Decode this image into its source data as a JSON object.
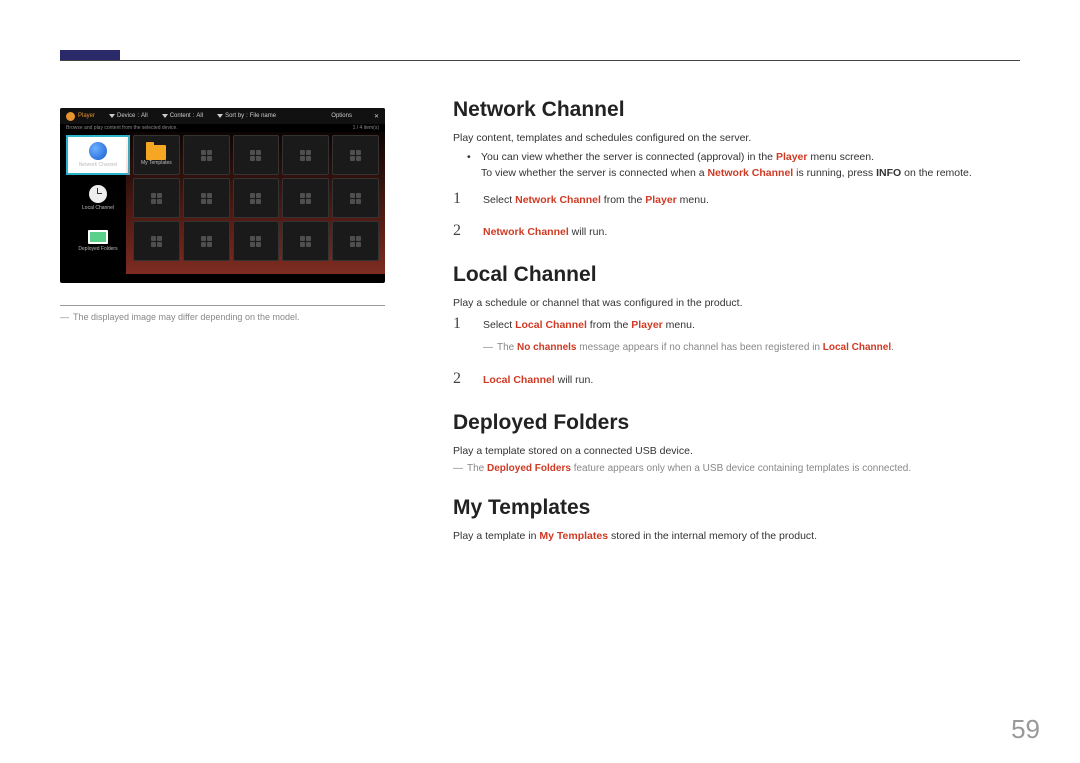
{
  "page_number": "59",
  "figure": {
    "header": {
      "player": "Player",
      "device": "Device",
      "device_val": "All",
      "content": "Content",
      "content_val": "All",
      "sortby": "Sort by",
      "sortby_val": "File name",
      "options": "Options",
      "close": "✕"
    },
    "subline_left": "Browse and play content from the selected device.",
    "subline_right": "1 / 4 item(s)",
    "side": {
      "network": "Network Channel",
      "templates": "My Templates",
      "local": "Local Channel",
      "deployed": "Deployed Folders"
    }
  },
  "figure_note": "The displayed image may differ depending on the model.",
  "sections": {
    "network": {
      "heading": "Network Channel",
      "desc": "Play content, templates and schedules configured on the server.",
      "bullet_pre": "You can view whether the server is connected (approval) in the ",
      "bullet_hl1": "Player",
      "bullet_post1": " menu screen.",
      "bullet_line2_pre": "To view whether the server is connected when a ",
      "bullet_line2_hl": "Network Channel",
      "bullet_line2_mid": " is running, press ",
      "bullet_line2_bold": "INFO",
      "bullet_line2_post": " on the remote.",
      "step1_pre": "Select ",
      "step1_hl1": "Network Channel",
      "step1_mid": " from the ",
      "step1_hl2": "Player",
      "step1_post": " menu.",
      "step2_hl": "Network Channel",
      "step2_post": " will run."
    },
    "local": {
      "heading": "Local Channel",
      "desc": "Play a schedule or channel that was configured in the product.",
      "step1_pre": "Select ",
      "step1_hl1": "Local Channel",
      "step1_mid": " from the ",
      "step1_hl2": "Player",
      "step1_post": " menu.",
      "note_pre": "The ",
      "note_hl1": "No channels",
      "note_mid": " message appears if no channel has been registered in ",
      "note_hl2": "Local Channel",
      "note_post": ".",
      "step2_hl": "Local Channel",
      "step2_post": " will run."
    },
    "deployed": {
      "heading": "Deployed Folders",
      "desc": "Play a template stored on a connected USB device.",
      "note_pre": "The ",
      "note_hl": "Deployed Folders",
      "note_post": " feature appears only when a USB device containing templates is connected."
    },
    "mytemplates": {
      "heading": "My Templates",
      "desc_pre": "Play a template in ",
      "desc_hl": "My Templates",
      "desc_post": " stored in the internal memory of the product."
    }
  },
  "numbers": {
    "one": "1",
    "two": "2"
  },
  "dash": "―"
}
